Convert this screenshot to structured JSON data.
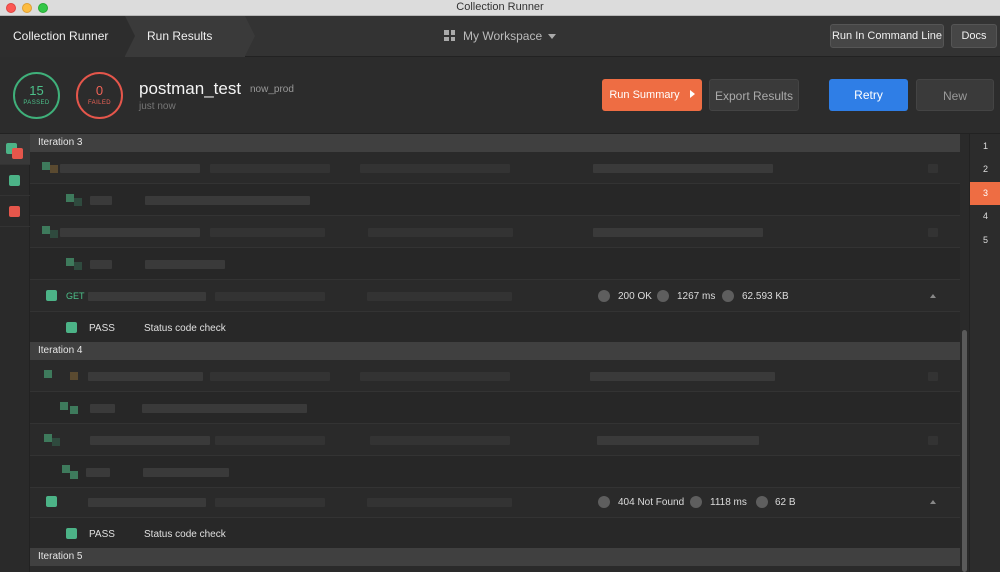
{
  "window": {
    "title": "Collection Runner"
  },
  "header": {
    "breadcrumb_root": "Collection Runner",
    "breadcrumb_current": "Run Results",
    "workspace": "My Workspace",
    "run_cli_label": "Run In Command Line",
    "docs_label": "Docs"
  },
  "summary": {
    "passed_count": "15",
    "passed_label": "PASSED",
    "failed_count": "0",
    "failed_label": "FAILED",
    "run_name": "postman_test",
    "environment": "now_prod",
    "time": "just now",
    "run_summary_label": "Run Summary",
    "export_label": "Export Results",
    "retry_label": "Retry",
    "new_label": "New"
  },
  "colors": {
    "pass": "#4cb387",
    "fail": "#e5564b",
    "accent": "#ee6d43",
    "primary": "#2f7ee6"
  },
  "iterations": [
    {
      "label": "Iteration 3"
    },
    {
      "label": "Iteration 4"
    },
    {
      "label": "Iteration 5"
    }
  ],
  "requests": [
    {
      "method": "GET",
      "status": "200 OK",
      "time": "1267 ms",
      "size": "62.593 KB",
      "test_result": "PASS",
      "test_name": "Status code check"
    },
    {
      "method": "",
      "status": "404 Not Found",
      "time": "1118 ms",
      "size": "62 B",
      "test_result": "PASS",
      "test_name": "Status code check"
    }
  ],
  "iteration_nav": [
    "1",
    "2",
    "3",
    "4",
    "5"
  ],
  "iteration_nav_active": "3"
}
